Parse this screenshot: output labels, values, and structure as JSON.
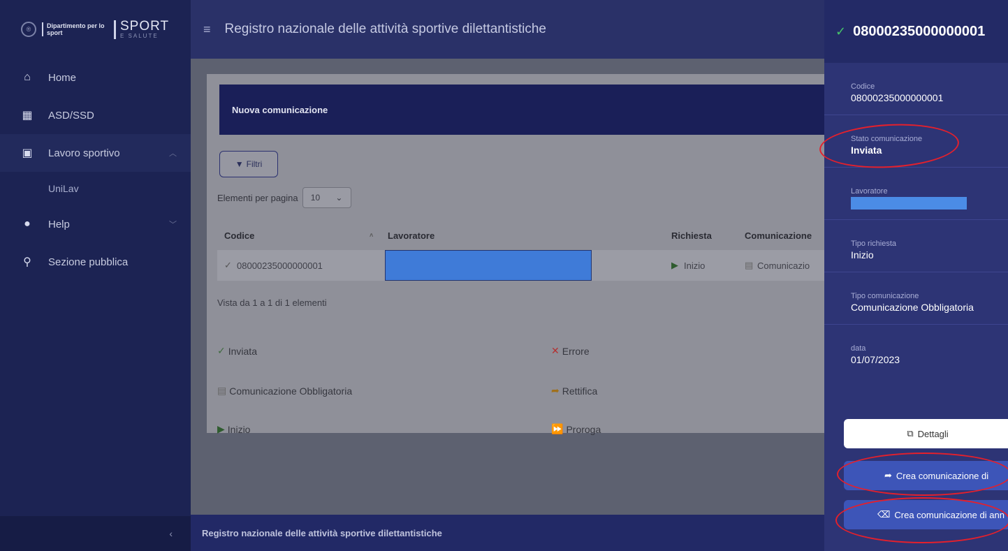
{
  "sidebar": {
    "logo": {
      "emblem": "®",
      "dept": "Dipartimento per lo sport",
      "brand": "SPORT",
      "brand_sub": "E SALUTE"
    },
    "items": [
      {
        "label": "Home",
        "icon": "home-icon"
      },
      {
        "label": "ASD/SSD",
        "icon": "building-icon"
      },
      {
        "label": "Lavoro sportivo",
        "icon": "briefcase-icon"
      },
      {
        "label": "UniLav"
      },
      {
        "label": "Help",
        "icon": "help-icon"
      },
      {
        "label": "Sezione pubblica",
        "icon": "search-icon"
      }
    ],
    "collapse": "‹"
  },
  "topbar": {
    "title": "Registro nazionale delle attività sportive dilettantistiche"
  },
  "main": {
    "card_title": "Nuova comunicazione",
    "filter_label": "Filtri",
    "per_page_label": "Elementi per pagina",
    "per_page_value": "10",
    "columns": [
      "Codice",
      "Lavoratore",
      "Richiesta",
      "Comunicazione"
    ],
    "row": {
      "code": "08000235000000001",
      "request": "Inizio",
      "communication": "Comunicazio"
    },
    "summary": "Vista da 1 a 1 di 1 elementi",
    "legend": [
      {
        "label": "Inviata",
        "icon": "check-icon"
      },
      {
        "label": "Errore",
        "icon": "x-icon"
      },
      {
        "label": "Comunicazione Obbligatoria",
        "icon": "document-icon"
      },
      {
        "label": "Rettifica",
        "icon": "share-icon"
      },
      {
        "label": "Inizio",
        "icon": "play-icon"
      },
      {
        "label": "Proroga",
        "icon": "fast-forward-icon"
      }
    ],
    "footer": "Registro nazionale delle attività sportive dilettantistiche"
  },
  "panel": {
    "title": "08000235000000001",
    "fields": [
      {
        "label": "Codice",
        "value": "08000235000000001"
      },
      {
        "label": "Stato comunicazione",
        "value": "Inviata"
      },
      {
        "label": "Lavoratore",
        "value": ""
      },
      {
        "label": "Tipo richiesta",
        "value": "Inizio"
      },
      {
        "label": "Tipo comunicazione",
        "value": "Comunicazione Obbligatoria"
      },
      {
        "label": "data",
        "value": "01/07/2023"
      }
    ],
    "buttons": {
      "details": "Dettagli",
      "create_rectify": "Crea comunicazione di",
      "create_cancel": "Crea comunicazione di ann"
    }
  },
  "colors": {
    "sidebar": "#1c2353",
    "panel": "#2d3475",
    "accent_blue": "#3f7bd8",
    "success": "#46c46a",
    "annotation": "#e4202c"
  }
}
